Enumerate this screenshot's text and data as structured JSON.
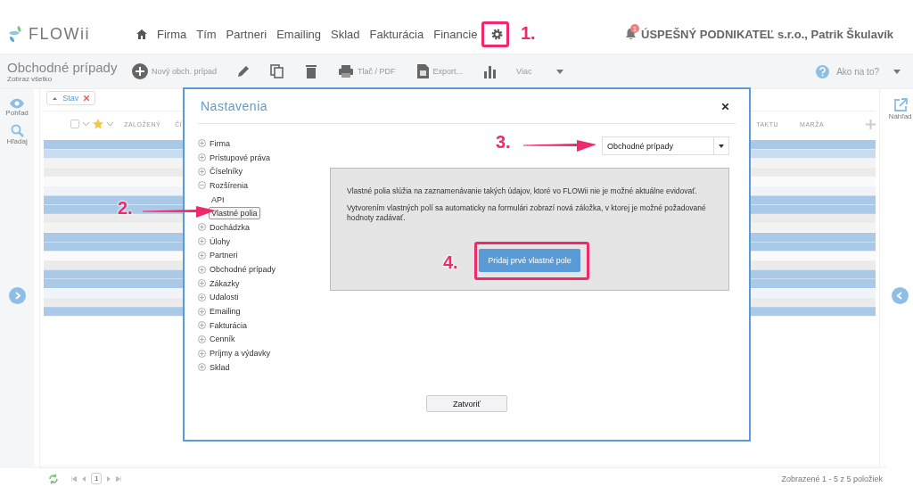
{
  "header": {
    "logo": "FLOWii",
    "nav": [
      {
        "label": "Firma"
      },
      {
        "label": "Tím"
      },
      {
        "label": "Partneri"
      },
      {
        "label": "Emailing"
      },
      {
        "label": "Sklad"
      },
      {
        "label": "Fakturácia"
      },
      {
        "label": "Financie"
      }
    ],
    "notification_count": "1",
    "account": "ÚSPEŠNÝ PODNIKATEĽ s.r.o., Patrik Škulavík"
  },
  "toolbar": {
    "title": "Obchodné prípady",
    "subtitle": "Zobraz všetko",
    "actions": [
      {
        "kind": "add",
        "label": "Nový obch. prípad"
      },
      {
        "kind": "edit"
      },
      {
        "kind": "copy"
      },
      {
        "kind": "delete"
      },
      {
        "kind": "print",
        "label": "Tlač / PDF"
      },
      {
        "kind": "export",
        "label": "Export..."
      },
      {
        "kind": "chart"
      },
      {
        "kind": "more",
        "label": "Viac"
      }
    ],
    "help": "Ako na to?"
  },
  "left_sidebar": [
    {
      "kind": "view",
      "label": "Pohľad"
    },
    {
      "kind": "search",
      "label": "Hľadaj"
    }
  ],
  "right_sidebar": [
    {
      "kind": "preview",
      "label": "Náhľad"
    }
  ],
  "filter_chip": {
    "label": "Stav"
  },
  "table": {
    "select_all": {
      "checked": false
    },
    "columns_left": [
      "ZALOŽENÝ",
      "ČÍ"
    ],
    "columns_right": [
      "TAKTU",
      "MARŽA"
    ]
  },
  "dialog": {
    "title": "Nastavenia",
    "tree": [
      {
        "label": "Firma",
        "expanded": false
      },
      {
        "label": "Prístupové práva",
        "expanded": false
      },
      {
        "label": "Číselníky",
        "expanded": false
      },
      {
        "label": "Rozšírenia",
        "expanded": true,
        "children": [
          {
            "label": "API",
            "selected": false
          },
          {
            "label": "Vlastné polia",
            "selected": true
          }
        ]
      },
      {
        "label": "Dochádzka",
        "expanded": false
      },
      {
        "label": "Úlohy",
        "expanded": false
      },
      {
        "label": "Partneri",
        "expanded": false
      },
      {
        "label": "Obchodné prípady",
        "expanded": false
      },
      {
        "label": "Zákazky",
        "expanded": false
      },
      {
        "label": "Udalosti",
        "expanded": false
      },
      {
        "label": "Emailing",
        "expanded": false
      },
      {
        "label": "Fakturácia",
        "expanded": false
      },
      {
        "label": "Cenník",
        "expanded": false
      },
      {
        "label": "Príjmy a výdavky",
        "expanded": false
      },
      {
        "label": "Sklad",
        "expanded": false
      }
    ],
    "select": {
      "value": "Obchodné prípady"
    },
    "info": [
      "Vlastné polia slúžia na zaznamenávanie takých údajov, ktoré vo FLOWii nie je možné aktuálne evidovať.",
      "Vytvorením vlastných polí sa automaticky na formulári zobrazí nová záložka, v ktorej je možné požadované hodnoty zadávať."
    ],
    "add_button": "Pridaj prvé vlastné pole",
    "close_button": "Zatvoriť"
  },
  "annotations": [
    {
      "label": "1."
    },
    {
      "label": "2."
    },
    {
      "label": "3."
    },
    {
      "label": "4."
    }
  ],
  "footer": {
    "page": "1",
    "summary": "Zobrazené 1 - 5 z 5 položiek"
  }
}
